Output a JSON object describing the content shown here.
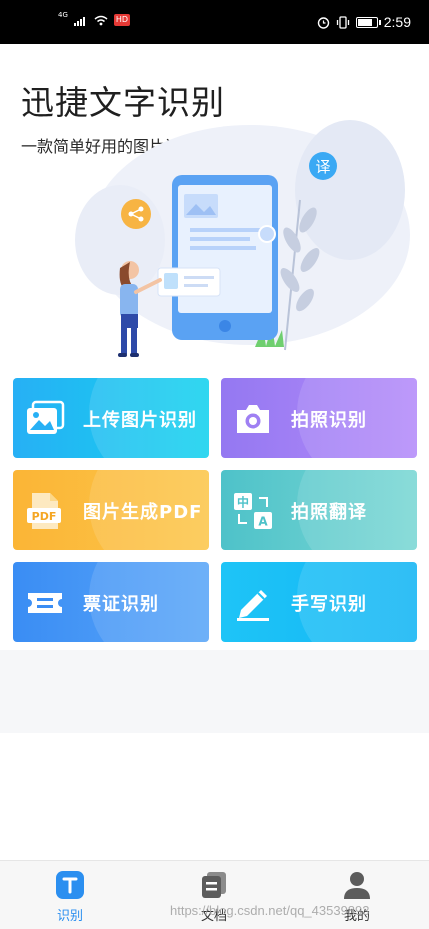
{
  "status_bar": {
    "network": "4G",
    "badge": "HD",
    "time": "2:59",
    "battery_level": 0.85
  },
  "hero": {
    "title": "迅捷文字识别",
    "subtitle": "一款简单好用的图片识别文字产品",
    "translate_badge": "译"
  },
  "features": [
    {
      "label": "上传图片识别",
      "icon": "image-upload-icon",
      "color_from": "#27b0f5",
      "color_to": "#14d2ee"
    },
    {
      "label": "拍照识别",
      "icon": "camera-icon",
      "color_from": "#9478f1",
      "color_to": "#b48bfa"
    },
    {
      "label": "图片生成PDF",
      "icon": "pdf-icon",
      "color_from": "#fbb536",
      "color_to": "#fcc64a"
    },
    {
      "label": "拍照翻译",
      "icon": "translate-icon",
      "color_from": "#4ec2c9",
      "color_to": "#7ad7d4"
    },
    {
      "label": "票证识别",
      "icon": "ticket-icon",
      "color_from": "#3a8df4",
      "color_to": "#5aa6f8"
    },
    {
      "label": "手写识别",
      "icon": "handwriting-icon",
      "color_from": "#1ec4f7",
      "color_to": "#14b6f4"
    }
  ],
  "icon_text": {
    "pdf": "PDF",
    "translate_zh": "中",
    "translate_a": "A"
  },
  "tabs": [
    {
      "label": "识别",
      "icon": "recognize-icon",
      "active": true
    },
    {
      "label": "文档",
      "icon": "documents-icon",
      "active": false
    },
    {
      "label": "我的",
      "icon": "profile-icon",
      "active": false
    }
  ],
  "watermark": "https://blog.csdn.net/qq_43539893",
  "colors": {
    "accent": "#2b8ff0",
    "tab_inactive": "#333333"
  }
}
